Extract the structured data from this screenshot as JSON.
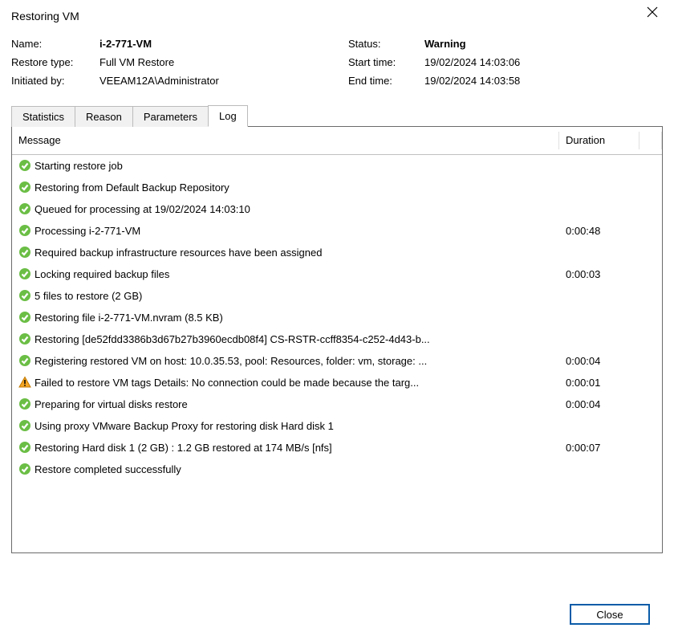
{
  "dialog": {
    "title": "Restoring VM"
  },
  "header": {
    "name_label": "Name:",
    "name_value": "i-2-771-VM",
    "restore_type_label": "Restore type:",
    "restore_type_value": "Full VM Restore",
    "initiated_by_label": "Initiated by:",
    "initiated_by_value": "VEEAM12A\\Administrator",
    "status_label": "Status:",
    "status_value": "Warning",
    "start_time_label": "Start time:",
    "start_time_value": "19/02/2024 14:03:06",
    "end_time_label": "End time:",
    "end_time_value": "19/02/2024 14:03:58"
  },
  "tabs": {
    "statistics": "Statistics",
    "reason": "Reason",
    "parameters": "Parameters",
    "log": "Log"
  },
  "table": {
    "message_header": "Message",
    "duration_header": "Duration"
  },
  "log_entries": [
    {
      "status": "ok",
      "message": "Starting restore job",
      "duration": ""
    },
    {
      "status": "ok",
      "message": "Restoring from Default Backup Repository",
      "duration": ""
    },
    {
      "status": "ok",
      "message": "Queued for processing at 19/02/2024 14:03:10",
      "duration": ""
    },
    {
      "status": "ok",
      "message": "Processing i-2-771-VM",
      "duration": "0:00:48"
    },
    {
      "status": "ok",
      "message": "Required backup infrastructure resources have been assigned",
      "duration": ""
    },
    {
      "status": "ok",
      "message": "Locking required backup files",
      "duration": "0:00:03"
    },
    {
      "status": "ok",
      "message": "5 files to restore (2 GB)",
      "duration": ""
    },
    {
      "status": "ok",
      "message": "Restoring file i-2-771-VM.nvram (8.5 KB)",
      "duration": ""
    },
    {
      "status": "ok",
      "message": "Restoring [de52fdd3386b3d67b27b3960ecdb08f4] CS-RSTR-ccff8354-c252-4d43-b...",
      "duration": ""
    },
    {
      "status": "ok",
      "message": "Registering restored VM on host: 10.0.35.53, pool: Resources, folder: vm, storage: ...",
      "duration": "0:00:04"
    },
    {
      "status": "warn",
      "message": "Failed to restore VM tags Details: No connection could be made because the targ...",
      "duration": "0:00:01"
    },
    {
      "status": "ok",
      "message": "Preparing for virtual disks restore",
      "duration": "0:00:04"
    },
    {
      "status": "ok",
      "message": "Using proxy VMware Backup Proxy for restoring disk Hard disk 1",
      "duration": ""
    },
    {
      "status": "ok",
      "message": "Restoring Hard disk 1 (2 GB) : 1.2 GB restored at 174 MB/s  [nfs]",
      "duration": "0:00:07"
    },
    {
      "status": "ok",
      "message": "Restore completed successfully",
      "duration": ""
    }
  ],
  "footer": {
    "close_label": "Close"
  }
}
